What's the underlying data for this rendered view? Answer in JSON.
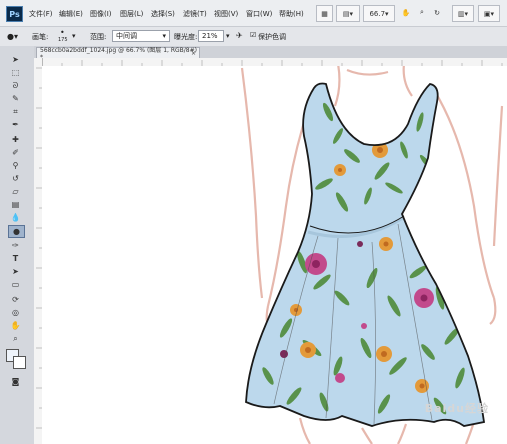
{
  "app": {
    "logo": "Ps"
  },
  "menu": {
    "items": [
      "文件(F)",
      "编辑(E)",
      "图像(I)",
      "图层(L)",
      "选择(S)",
      "滤镜(T)",
      "视图(V)",
      "窗口(W)",
      "帮助(H)"
    ],
    "zoom": "66.7"
  },
  "options": {
    "range_label": "范围:",
    "range_value": "中间调",
    "exposure_label": "曝光度:",
    "exposure_value": "21%",
    "protect_label": "保护色调",
    "brush_size": "175",
    "brush_label": "画笔:"
  },
  "document": {
    "tab_title": "568ccb0a2bddf_1024.jpg @ 66.7% (图层 1, RGB/8#) *"
  },
  "colors": {
    "dress_base": "#bcd8ec",
    "leaf": "#4e8b3a",
    "flower_orange": "#e39a3a",
    "flower_pink": "#c24a8c",
    "sketch": "#e6b8ad"
  },
  "watermark": "Baidu经验"
}
